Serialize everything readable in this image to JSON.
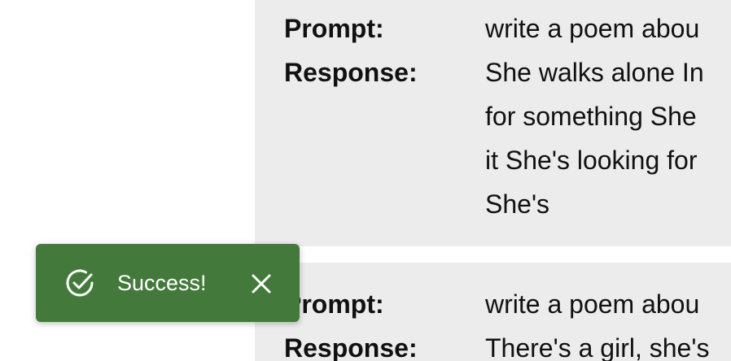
{
  "entries": [
    {
      "prompt_label": "Prompt:",
      "prompt_value": "write a poem abou",
      "response_label": "Response:",
      "response_lines": [
        "She walks alone In",
        "for something She",
        "it She's looking for",
        "She's"
      ]
    },
    {
      "prompt_label": "Prompt:",
      "prompt_value": "write a poem abou",
      "response_label": "Response:",
      "response_lines": [
        "There's a girl, she's"
      ]
    }
  ],
  "toast": {
    "message": "Success!",
    "icon": "check-circle-icon",
    "close_icon": "close-icon",
    "background": "#437a3b"
  }
}
